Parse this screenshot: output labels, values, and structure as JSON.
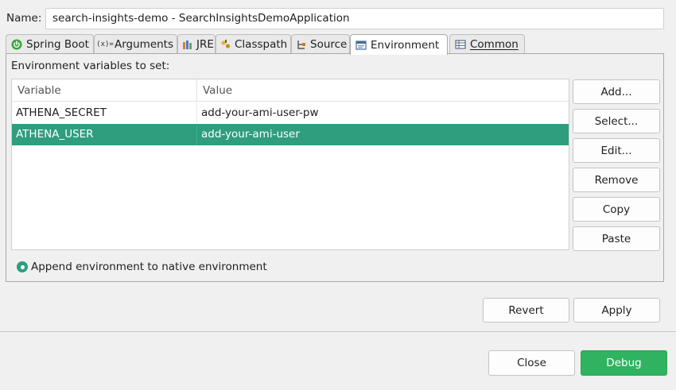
{
  "name_field": {
    "label": "Name:",
    "value": "search-insights-demo - SearchInsightsDemoApplication"
  },
  "tabs": [
    {
      "label": "Spring Boot",
      "icon": "spring-boot-icon",
      "active": false
    },
    {
      "label": "Arguments",
      "icon": "arguments-icon",
      "active": false
    },
    {
      "label": "JRE",
      "icon": "jre-icon",
      "active": false
    },
    {
      "label": "Classpath",
      "icon": "classpath-icon",
      "active": false
    },
    {
      "label": "Source",
      "icon": "source-icon",
      "active": false
    },
    {
      "label": "Environment",
      "icon": "environment-icon",
      "active": true
    },
    {
      "label": "Common",
      "icon": "common-icon",
      "active": false
    }
  ],
  "environment": {
    "section_label": "Environment variables to set:",
    "columns": [
      "Variable",
      "Value"
    ],
    "rows": [
      {
        "variable": "ATHENA_SECRET",
        "value": "add-your-ami-user-pw",
        "selected": false
      },
      {
        "variable": "ATHENA_USER",
        "value": "add-your-ami-user",
        "selected": true
      }
    ],
    "side_buttons": {
      "add": "Add...",
      "select": "Select...",
      "edit": "Edit...",
      "remove": "Remove",
      "copy": "Copy",
      "paste": "Paste"
    },
    "append_option": "Append environment to native environment"
  },
  "panel_buttons": {
    "revert": "Revert",
    "apply": "Apply"
  },
  "dialog_buttons": {
    "close": "Close",
    "debug": "Debug"
  },
  "colors": {
    "selection": "#2e9e7f",
    "primary": "#2fb360"
  }
}
